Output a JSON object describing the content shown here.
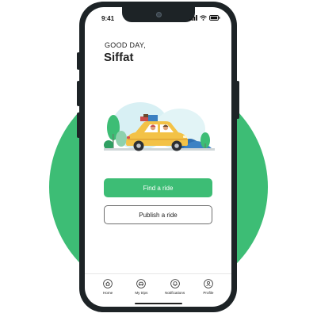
{
  "status_bar": {
    "time": "9:41"
  },
  "home": {
    "greeting": "GOOD DAY,",
    "user_name": "Siffat",
    "illustration": "car-road-trip-illustration"
  },
  "actions": {
    "find_label": "Find a ride",
    "publish_label": "Publish a ride"
  },
  "tabbar": {
    "items": [
      {
        "label": "Home",
        "icon": "home-icon"
      },
      {
        "label": "My trips",
        "icon": "car-icon"
      },
      {
        "label": "Notifications",
        "icon": "bell-icon"
      },
      {
        "label": "Profile",
        "icon": "profile-icon"
      }
    ]
  },
  "colors": {
    "accent": "#3dbd75",
    "phone_frame": "#1d2326",
    "car": "#f3c247",
    "illustration_sky": "#d8f0f4"
  }
}
